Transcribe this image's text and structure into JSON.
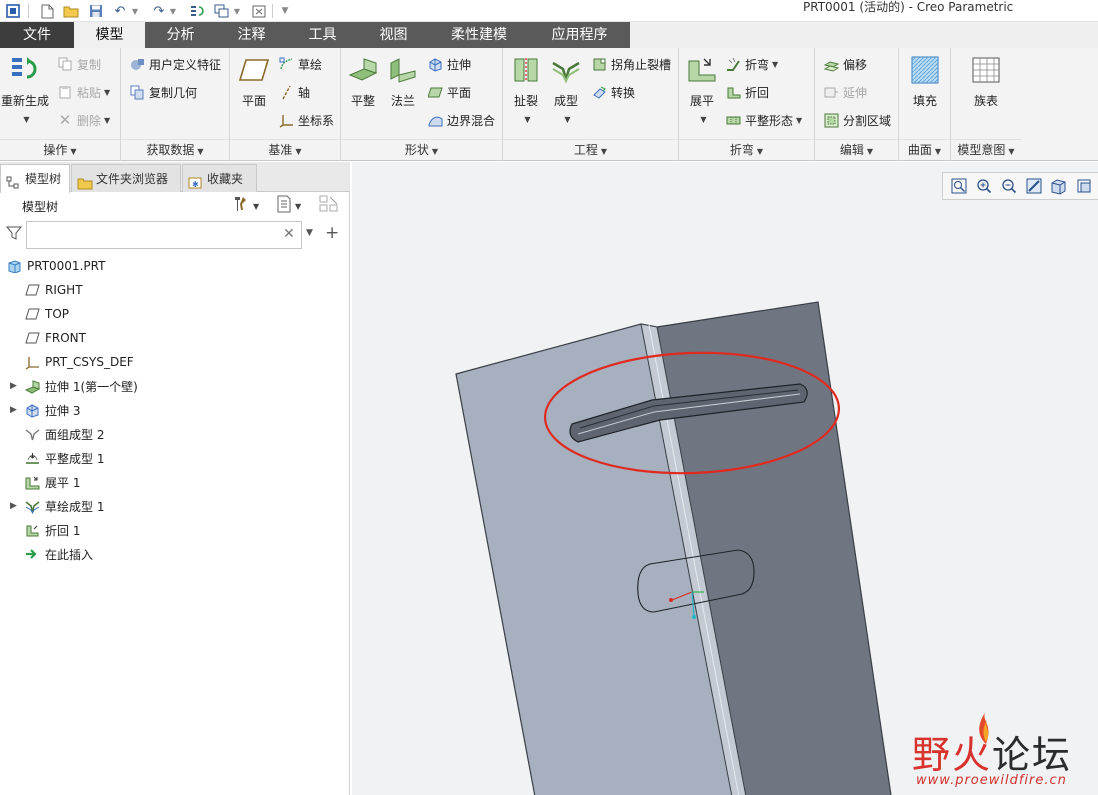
{
  "window": {
    "title": "PRT0001 (活动的) - Creo Parametric"
  },
  "tabs": [
    {
      "label": "文件"
    },
    {
      "label": "模型"
    },
    {
      "label": "分析"
    },
    {
      "label": "注释"
    },
    {
      "label": "工具"
    },
    {
      "label": "视图"
    },
    {
      "label": "柔性建模"
    },
    {
      "label": "应用程序"
    }
  ],
  "ribbon": {
    "operations": {
      "label": "操作",
      "regen": "重新生成",
      "copy": "复制",
      "paste": "粘贴",
      "delete": "删除"
    },
    "get_data": {
      "label": "获取数据",
      "udf": "用户定义特征",
      "copy_geom": "复制几何"
    },
    "datum": {
      "label": "基准",
      "plane": "平面",
      "sketch": "草绘",
      "axis": "轴",
      "csys": "坐标系"
    },
    "shapes": {
      "label": "形状",
      "flat": "平整",
      "flange": "法兰",
      "extrude": "拉伸",
      "plane": "平面",
      "blend": "边界混合"
    },
    "engineering": {
      "label": "工程",
      "rip": "扯裂",
      "form": "成型",
      "corner_relief": "拐角止裂槽",
      "convert": "转换"
    },
    "bends": {
      "label": "折弯",
      "unbend": "展平",
      "bend": "折弯",
      "bend_back": "折回",
      "flat_state": "平整形态"
    },
    "editing": {
      "label": "编辑",
      "offset": "偏移",
      "extend": "延伸",
      "split": "分割区域"
    },
    "surfaces": {
      "label": "曲面",
      "fill": "填充"
    },
    "intent": {
      "label": "模型意图",
      "family": "族表"
    }
  },
  "panel": {
    "tabs": [
      {
        "label": "模型树"
      },
      {
        "label": "文件夹浏览器"
      },
      {
        "label": "收藏夹"
      }
    ],
    "tree_header": "模型树",
    "search_value": "",
    "tree": [
      {
        "label": "PRT0001.PRT"
      },
      {
        "label": "RIGHT"
      },
      {
        "label": "TOP"
      },
      {
        "label": "FRONT"
      },
      {
        "label": "PRT_CSYS_DEF"
      },
      {
        "label": "拉伸 1(第一个壁)"
      },
      {
        "label": "拉伸 3"
      },
      {
        "label": "面组成型 2"
      },
      {
        "label": "平整成型 1"
      },
      {
        "label": "展平 1"
      },
      {
        "label": "草绘成型 1"
      },
      {
        "label": "折回 1"
      },
      {
        "label": "在此插入"
      }
    ]
  },
  "watermark": {
    "main_red": "野火",
    "main_dark": "论坛",
    "sub": "www.proewildfire.cn"
  },
  "colors": {
    "tab_bar": "#5a5a5a",
    "file_tab": "#3d3d3d",
    "ribbon": "#f3f3f3",
    "viewport": "#f1f2f4",
    "part_light": "#a3adbb",
    "part_dark": "#6d7480",
    "highlight": "#e02a20"
  }
}
